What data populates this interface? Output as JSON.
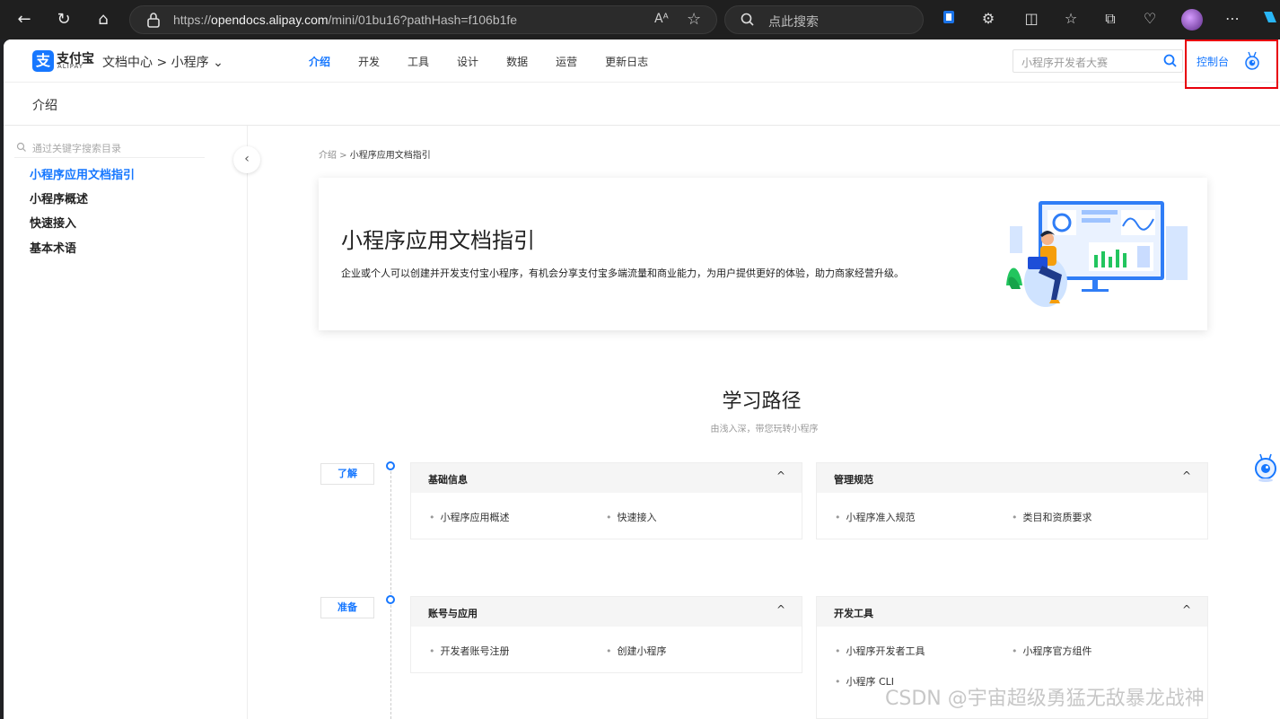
{
  "browser": {
    "url_prefix": "https://",
    "url_host": "opendocs.alipay.com",
    "url_path": "/mini/01bu16?pathHash=f106b1fe",
    "search_placeholder": "点此搜索",
    "read_aloud": "Aᴬ"
  },
  "header": {
    "logo_text": "支付宝",
    "logo_sub": "ALIPAY",
    "logo_mark": "支",
    "breadcrumb": "文档中心 > 小程序 ⌄",
    "menu": [
      {
        "label": "介绍",
        "active": true
      },
      {
        "label": "开发"
      },
      {
        "label": "工具"
      },
      {
        "label": "设计"
      },
      {
        "label": "数据"
      },
      {
        "label": "运营"
      },
      {
        "label": "更新日志"
      }
    ],
    "search_placeholder": "小程序开发者大赛",
    "console_label": "控制台"
  },
  "subbar": {
    "title": "介绍"
  },
  "sidebar": {
    "search_placeholder": "通过关键字搜索目录",
    "items": [
      {
        "label": "小程序应用文档指引",
        "active": true
      },
      {
        "label": "小程序概述"
      },
      {
        "label": "快速接入"
      },
      {
        "label": "基本术语"
      }
    ]
  },
  "content": {
    "breadcrumb_parent": "介绍",
    "breadcrumb_sep": " > ",
    "breadcrumb_current": "小程序应用文档指引",
    "hero_title": "小程序应用文档指引",
    "hero_desc": "企业或个人可以创建并开发支付宝小程序，有机会分享支付宝多端流量和商业能力，为用户提供更好的体验，助力商家经营升级。",
    "path_title": "学习路径",
    "path_subtitle": "由浅入深，带您玩转小程序",
    "stages": [
      {
        "tag": "了解",
        "cards": [
          {
            "title": "基础信息",
            "links": [
              "小程序应用概述",
              "快速接入"
            ]
          },
          {
            "title": "管理规范",
            "links": [
              "小程序准入规范",
              "类目和资质要求"
            ]
          }
        ]
      },
      {
        "tag": "准备",
        "cards": [
          {
            "title": "账号与应用",
            "links": [
              "开发者账号注册",
              "创建小程序"
            ]
          },
          {
            "title": "开发工具",
            "links": [
              "小程序开发者工具",
              "小程序官方组件",
              "小程序 CLI"
            ]
          }
        ]
      }
    ]
  },
  "watermark": "CSDN @宇宙超级勇猛无敌暴龙战神",
  "colors": {
    "accent": "#1677ff",
    "highlight_box": "#e8000b"
  }
}
